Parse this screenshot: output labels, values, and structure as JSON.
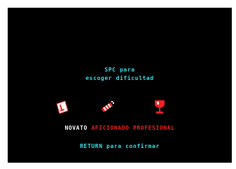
{
  "screen": {
    "background": "#000000",
    "prompt_line1": "SPC para",
    "prompt_line2": "escoger dificultad",
    "prompt_color": "#38e0e8"
  },
  "icons": [
    {
      "name": "l-plate-icon",
      "color": "#f02020"
    },
    {
      "name": "firecracker-icon",
      "color": "#f02020"
    },
    {
      "name": "trophy-icon",
      "color": "#f02020"
    }
  ],
  "difficulty": {
    "options": [
      {
        "label": "NOVATO",
        "selected": true
      },
      {
        "label": "AFICIONADO",
        "selected": false
      },
      {
        "label": "PROFESIONAL",
        "selected": false
      }
    ],
    "selected_color": "#ffffff",
    "unselected_color": "#f02020"
  },
  "footer": {
    "confirm_text": "RETURN para confirmar"
  }
}
